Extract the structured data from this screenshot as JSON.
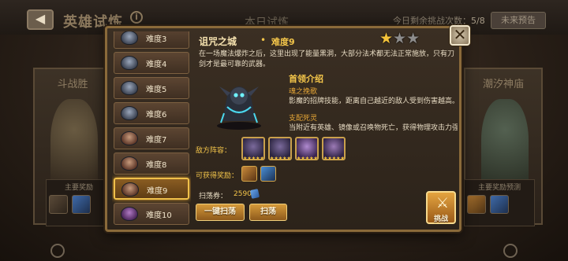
{
  "topbar": {
    "back_icon": "back-arrow-icon",
    "title": "英雄试炼",
    "info_icon": "info-icon",
    "today_title": "本日试炼",
    "remaining_label": "今日剩余挑战次数：",
    "remaining_value": "5/8",
    "coming_soon": "未来预告"
  },
  "background": {
    "left_panel_label": "斗战胜",
    "right_panel_label": "潮汐神庙",
    "left_rewards_label": "主要奖励",
    "right_rewards_label": "主要奖励预测"
  },
  "difficulty_list": [
    {
      "label": "难度3",
      "selected": false
    },
    {
      "label": "难度4",
      "selected": false
    },
    {
      "label": "难度5",
      "selected": false
    },
    {
      "label": "难度6",
      "selected": false
    },
    {
      "label": "难度7",
      "selected": false
    },
    {
      "label": "难度8",
      "selected": false
    },
    {
      "label": "难度9",
      "selected": true
    },
    {
      "label": "难度10",
      "selected": false
    }
  ],
  "detail": {
    "level_name": "诅咒之城",
    "dot": "•",
    "difficulty": "难度9",
    "stars": {
      "earned": 1,
      "total": 3
    },
    "description": "在一场魔法爆炸之后，这里出现了能量黑洞，大部分法术都无法正常施放，只有刀剑才是最可靠的武器。",
    "boss_title": "首领介绍",
    "skills": [
      {
        "name": "魂之挽歌",
        "desc": "影魔的招牌技能，距离自己越近的敌人受到伤害越高。"
      },
      {
        "name": "支配死灵",
        "desc": "当附近有英雄、镜像或召唤物死亡，获得物理攻击力强化"
      }
    ],
    "enemy_label": "敌方阵容：",
    "enemies": [
      "enemy-1",
      "enemy-2",
      "enemy-3",
      "enemy-4"
    ],
    "enemy_stars": "★★★★★",
    "rewards_label": "可获得奖励：",
    "rewards": [
      "reward-1",
      "reward-2"
    ],
    "sweep_label": "扫荡券：",
    "sweep_count": "2590",
    "sweep_all_button": "一键扫荡",
    "sweep_button": "扫荡",
    "fight_button": "挑战"
  },
  "colors": {
    "accent_gold": "#f3c54a",
    "selected_border": "#f0c04a",
    "skill_name": "#e7a736"
  }
}
